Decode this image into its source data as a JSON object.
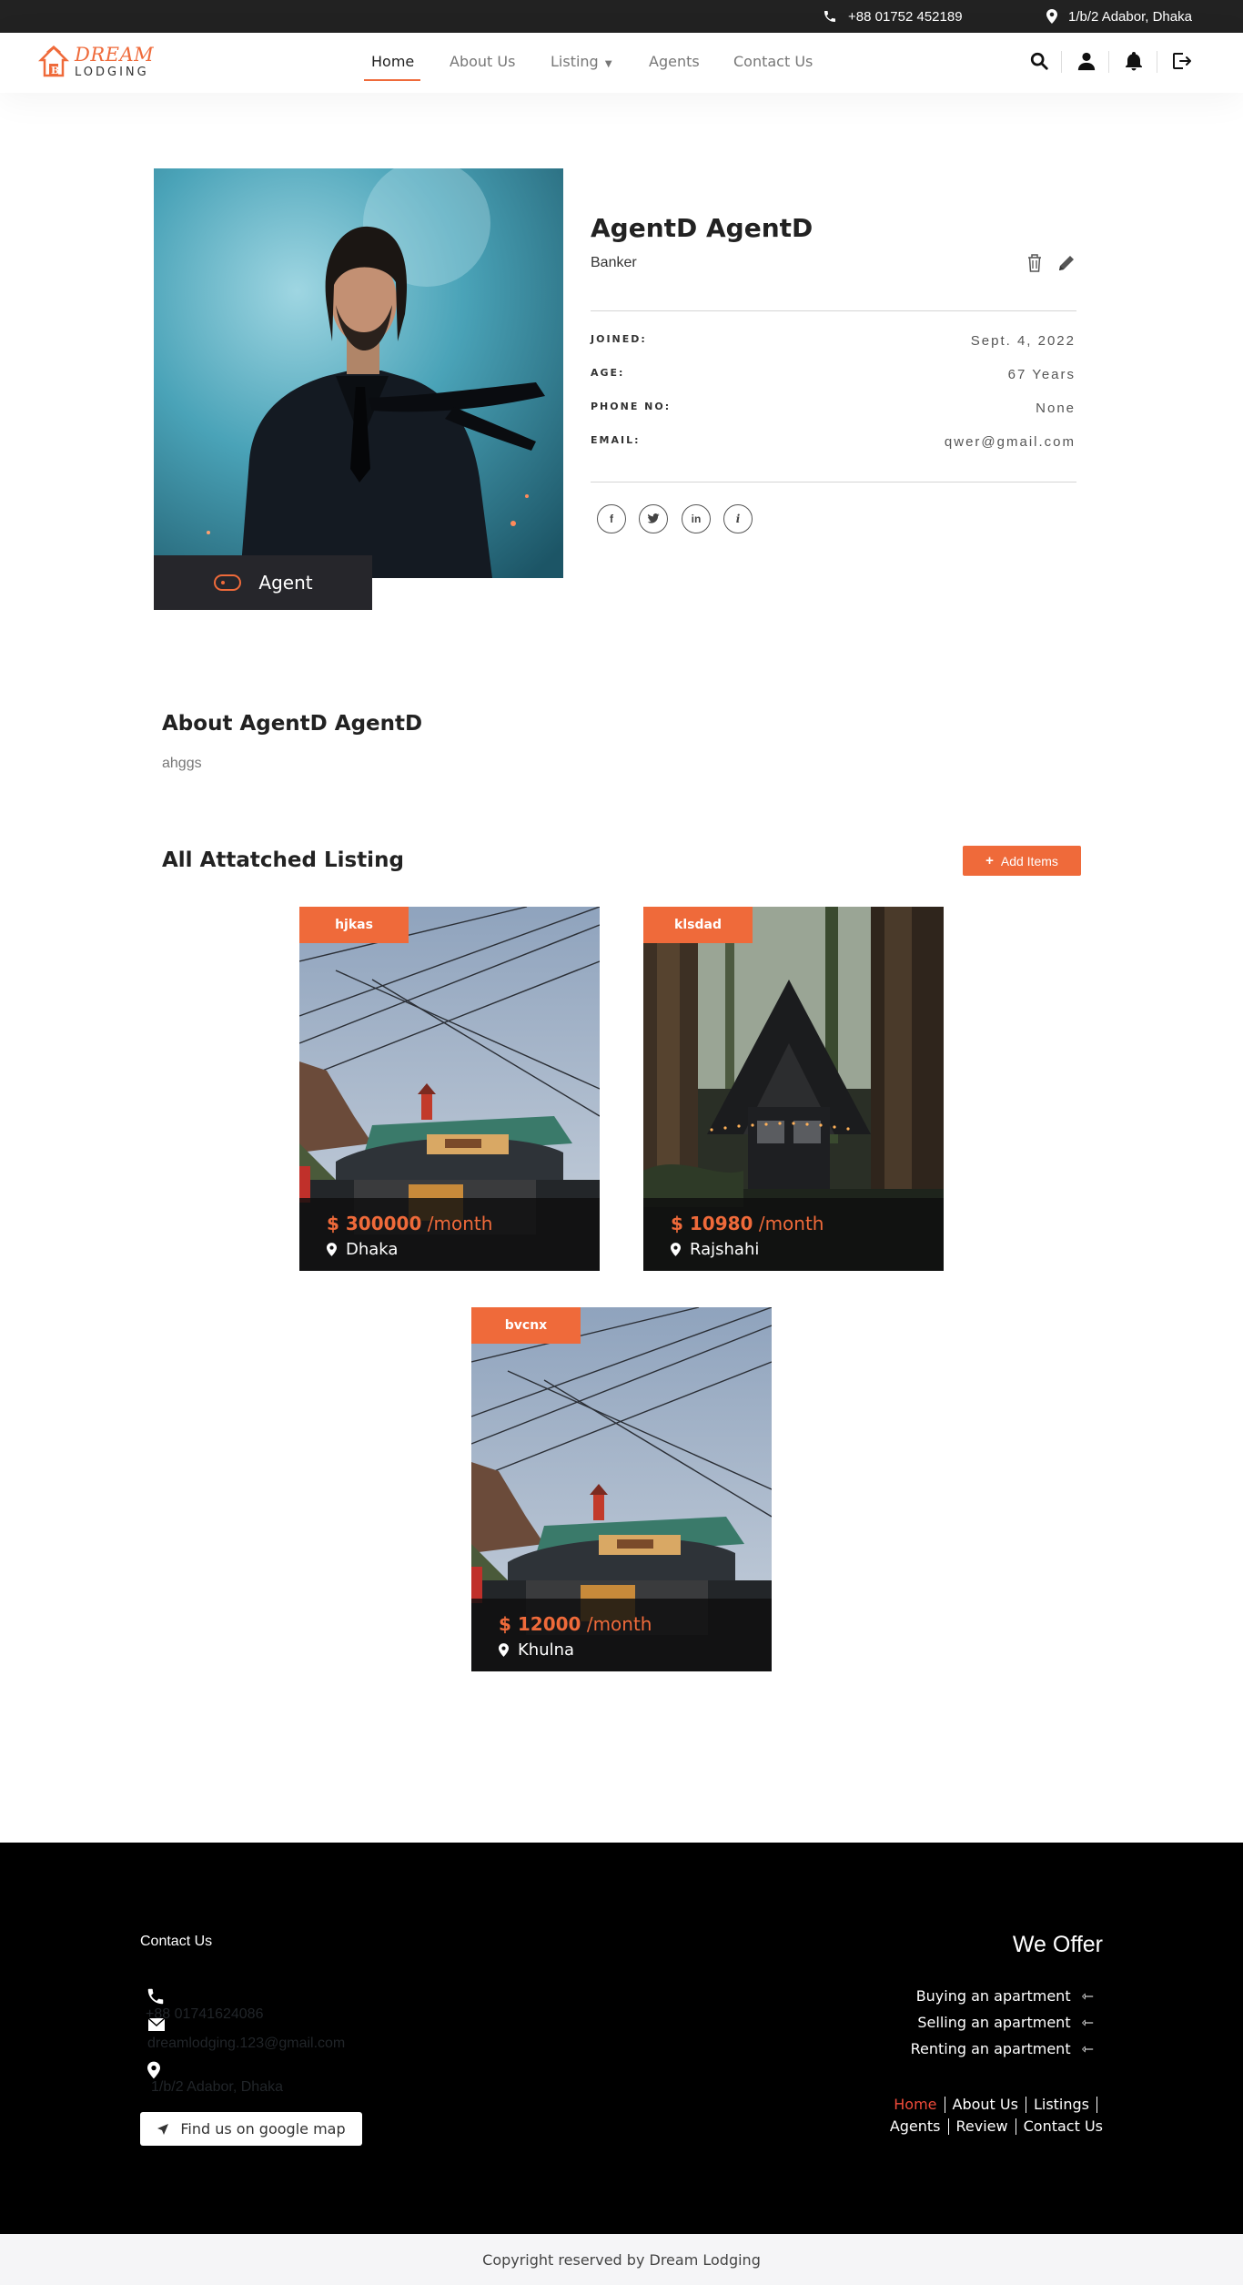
{
  "topbar": {
    "phone": "+88 01752 452189",
    "address": "1/b/2 Adabor, Dhaka"
  },
  "brand": {
    "line1": "DREAM",
    "line2": "LODGING",
    "accent": "#ef6a3a"
  },
  "nav": {
    "items": [
      {
        "label": "Home",
        "active": true
      },
      {
        "label": "About Us"
      },
      {
        "label": "Listing"
      },
      {
        "label": "Agents"
      },
      {
        "label": "Contact Us"
      }
    ],
    "icons": [
      "search-icon",
      "user-icon",
      "bell-icon",
      "logout-icon"
    ]
  },
  "agent": {
    "name": "AgentD AgentD",
    "role": "Banker",
    "badge": "Agent",
    "details": [
      {
        "label": "JOINED:",
        "value": "Sept. 4, 2022"
      },
      {
        "label": "AGE:",
        "value": "67 Years"
      },
      {
        "label": "PHONE NO:",
        "value": "None"
      },
      {
        "label": "EMAIL:",
        "value": "qwer@gmail.com"
      }
    ],
    "social": [
      "facebook-icon",
      "twitter-icon",
      "linkedin-icon",
      "info-icon"
    ]
  },
  "about": {
    "title": "About AgentD AgentD",
    "text": "ahggs"
  },
  "listing": {
    "title": "All Attatched Listing",
    "add_label": "Add Items",
    "cards": [
      {
        "tag": "hjkas",
        "price": "$ 300000",
        "period": "/month",
        "location": "Dhaka",
        "image": "train-station"
      },
      {
        "tag": "klsdad",
        "price": "$ 10980",
        "period": "/month",
        "location": "Rajshahi",
        "image": "cabin-forest"
      },
      {
        "tag": "bvcnx",
        "price": "$ 12000",
        "period": "/month",
        "location": "Khulna",
        "image": "train-station"
      }
    ]
  },
  "footer": {
    "contact_title": "Contact Us",
    "phone": "+88 01741624086",
    "email": "dreamlodging.123@gmail.com",
    "address": "1/b/2 Adabor, Dhaka",
    "map_button": "Find us on google map",
    "offer_title": "We Offer",
    "offers": [
      "Buying an apartment",
      "Selling an apartment",
      "Renting an apartment"
    ],
    "links_row1": [
      "Home",
      "About Us",
      "Listings"
    ],
    "links_row2": [
      "Agents",
      "Review",
      "Contact Us"
    ],
    "copyright": "Copyright reserved by Dream Lodging"
  }
}
